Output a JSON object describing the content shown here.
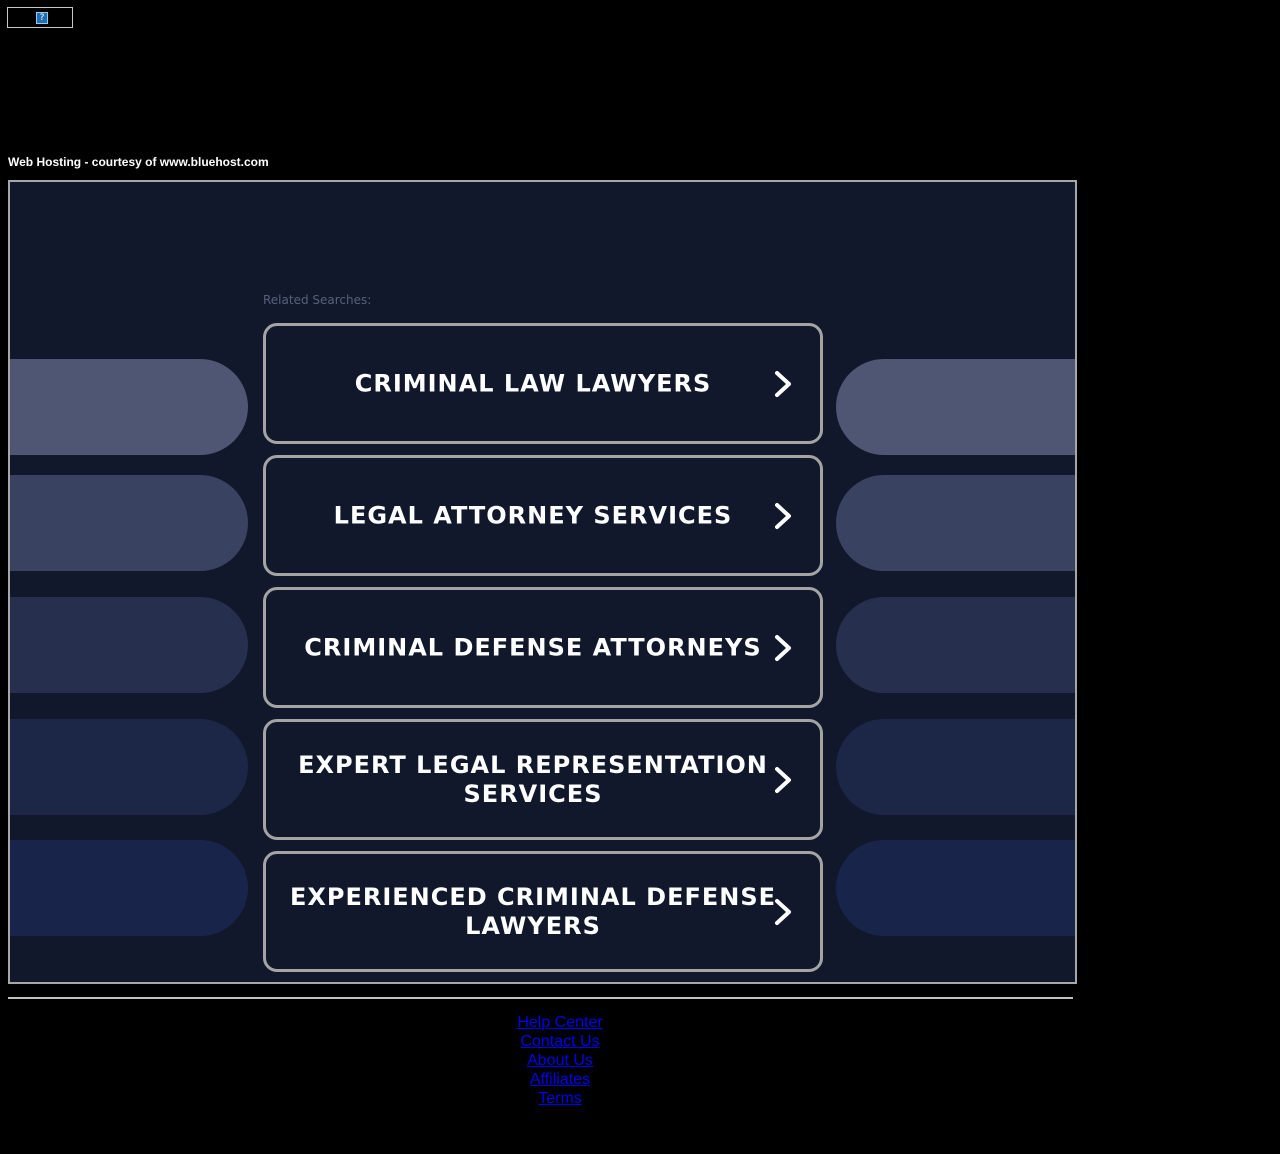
{
  "header": {
    "broken_image_icon": "?",
    "hosting_text": "Web Hosting - courtesy of www.bluehost.com"
  },
  "main": {
    "related_label": "Related Searches:",
    "searches": [
      {
        "label": "CRIMINAL LAW LAWYERS"
      },
      {
        "label": "LEGAL ATTORNEY SERVICES"
      },
      {
        "label": "CRIMINAL DEFENSE ATTORNEYS"
      },
      {
        "label": "EXPERT LEGAL REPRESENTATION SERVICES"
      },
      {
        "label": "EXPERIENCED CRIMINAL DEFENSE LAWYERS"
      }
    ],
    "pill_colors": [
      "#4e5673",
      "#3a4262",
      "#262f4e",
      "#1c2646",
      "#19244a"
    ],
    "accent_border": "#a4a4a4",
    "background": "#11182c"
  },
  "footer": {
    "links": [
      {
        "label": "Help Center"
      },
      {
        "label": "Contact Us"
      },
      {
        "label": "About Us"
      },
      {
        "label": "Affiliates"
      },
      {
        "label": "Terms"
      }
    ]
  }
}
